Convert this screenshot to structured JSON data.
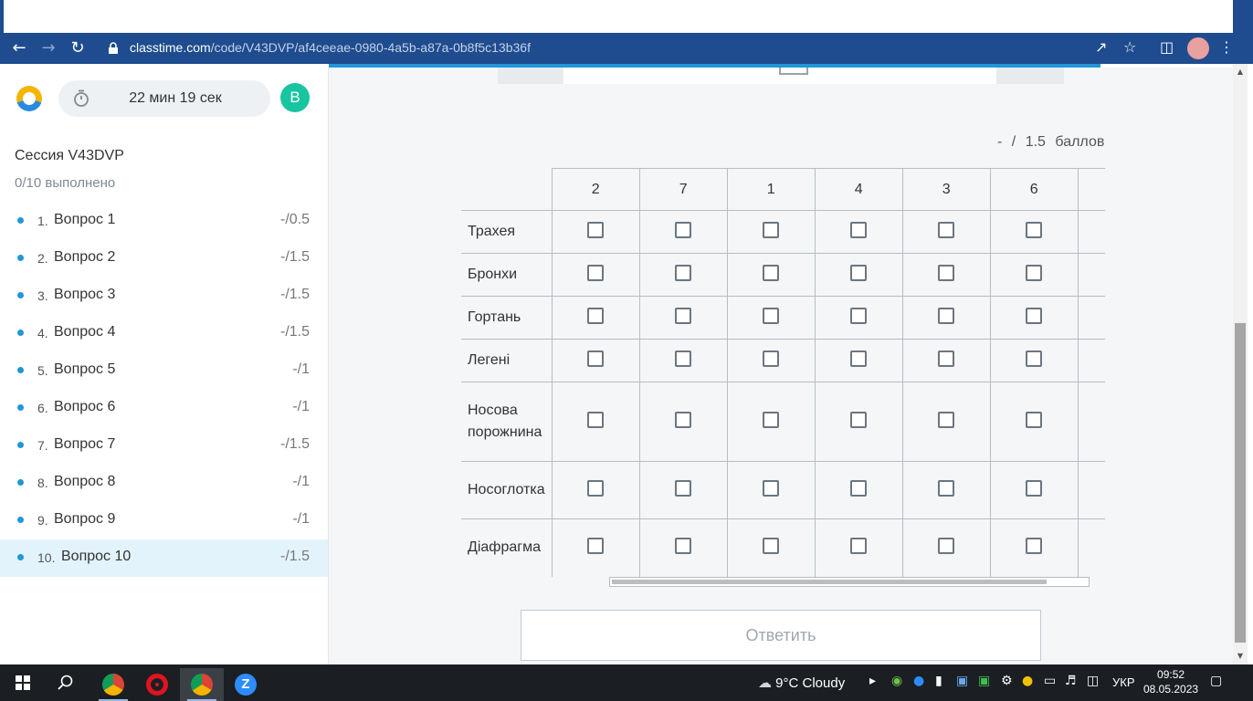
{
  "browser": {
    "url_host": "classtime.com",
    "url_path": "/code/V43DVP/af4ceeae-0980-4a5b-a87a-0b8f5c13b36f"
  },
  "sidebar": {
    "timer": "22 мин 19 сек",
    "user_initial": "В",
    "session_title": "Сессия V43DVP",
    "progress": "0/10 выполнено",
    "questions": [
      {
        "num": "1.",
        "label": "Вопрос 1",
        "score": "-/0.5"
      },
      {
        "num": "2.",
        "label": "Вопрос 2",
        "score": "-/1.5"
      },
      {
        "num": "3.",
        "label": "Вопрос 3",
        "score": "-/1.5"
      },
      {
        "num": "4.",
        "label": "Вопрос 4",
        "score": "-/1.5"
      },
      {
        "num": "5.",
        "label": "Вопрос 5",
        "score": "-/1"
      },
      {
        "num": "6.",
        "label": "Вопрос 6",
        "score": "-/1"
      },
      {
        "num": "7.",
        "label": "Вопрос 7",
        "score": "-/1.5"
      },
      {
        "num": "8.",
        "label": "Вопрос 8",
        "score": "-/1"
      },
      {
        "num": "9.",
        "label": "Вопрос 9",
        "score": "-/1"
      },
      {
        "num": "10.",
        "label": "Вопрос 10",
        "score": "-/1.5"
      }
    ]
  },
  "question": {
    "points_dash": "-",
    "points_slash": "/",
    "points_value": "1.5",
    "points_unit": "баллов",
    "columns": [
      "2",
      "7",
      "1",
      "4",
      "3",
      "6"
    ],
    "rows": [
      "Трахея",
      "Бронхи",
      "Гортань",
      "Легені",
      "Носова порожнина",
      "Носоглотка",
      "Діафрагма"
    ],
    "submit_label": "Ответить"
  },
  "taskbar": {
    "weather": "9°C  Cloudy",
    "language": "УКР",
    "time": "09:52",
    "date": "08.05.2023"
  }
}
